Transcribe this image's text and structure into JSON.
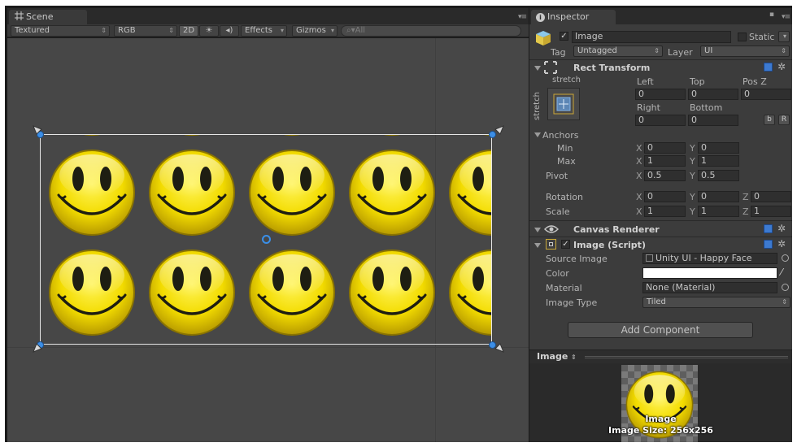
{
  "scene": {
    "tab_label": "Scene",
    "toolbar": {
      "draw_mode": "Textured",
      "render_mode": "RGB",
      "mode_2d": "2D",
      "effects": "Effects",
      "gizmos": "Gizmos",
      "search_placeholder": "All"
    }
  },
  "inspector": {
    "tab_label": "Inspector",
    "object": {
      "name": "Image",
      "static_label": "Static",
      "tag_label": "Tag",
      "tag_value": "Untagged",
      "layer_label": "Layer",
      "layer_value": "UI"
    },
    "rect_transform": {
      "title": "Rect Transform",
      "preset_h": "stretch",
      "preset_v": "stretch",
      "left_label": "Left",
      "top_label": "Top",
      "posz_label": "Pos Z",
      "left": "0",
      "top": "0",
      "posz": "0",
      "right_label": "Right",
      "bottom_label": "Bottom",
      "right": "0",
      "bottom": "0",
      "btn_b": "b",
      "btn_r": "R",
      "anchors_label": "Anchors",
      "min_label": "Min",
      "max_label": "Max",
      "min_x": "0",
      "min_y": "0",
      "max_x": "1",
      "max_y": "1",
      "pivot_label": "Pivot",
      "pivot_x": "0.5",
      "pivot_y": "0.5",
      "rotation_label": "Rotation",
      "rot_x": "0",
      "rot_y": "0",
      "rot_z": "0",
      "scale_label": "Scale",
      "scale_x": "1",
      "scale_y": "1",
      "scale_z": "1",
      "x": "X",
      "y": "Y",
      "z": "Z"
    },
    "canvas_renderer": {
      "title": "Canvas Renderer"
    },
    "image_script": {
      "title": "Image (Script)",
      "source_image_label": "Source Image",
      "source_image_value": "Unity UI - Happy Face",
      "color_label": "Color",
      "color_value": "#ffffff",
      "material_label": "Material",
      "material_value": "None (Material)",
      "image_type_label": "Image Type",
      "image_type_value": "Tiled"
    },
    "add_component": "Add Component",
    "preview": {
      "bar_label": "Image",
      "image_name": "Image",
      "image_size": "Image Size: 256x256"
    }
  }
}
